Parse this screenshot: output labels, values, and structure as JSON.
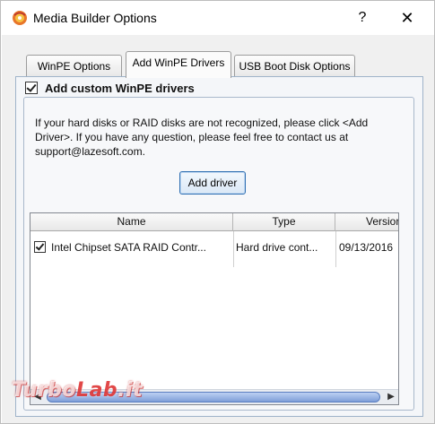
{
  "window": {
    "title": "Media Builder Options",
    "help_label": "?",
    "close_label": "✕"
  },
  "tabs": [
    {
      "label": "WinPE Options",
      "active": false
    },
    {
      "label": "Add WinPE Drivers",
      "active": true
    },
    {
      "label": "USB Boot Disk Options",
      "active": false
    }
  ],
  "group": {
    "checkbox_label": "Add custom WinPE drivers",
    "checked": true,
    "info_text": "If your hard disks or RAID disks are not recognized, please click <Add Driver>. If you have any question, please feel free to contact us at support@lazesoft.com.",
    "add_driver_label": "Add driver"
  },
  "table": {
    "columns": [
      "Name",
      "Type",
      "Versior"
    ],
    "rows": [
      {
        "checked": true,
        "name": "Intel Chipset SATA RAID Contr...",
        "type": "Hard drive cont...",
        "version": "09/13/2016"
      }
    ]
  },
  "scrollbar": {
    "left_arrow": "◀",
    "right_arrow": "▶"
  },
  "watermark": {
    "text_main": "Turbo",
    "text_accent": "Lab",
    "text_suffix": ".it"
  }
}
